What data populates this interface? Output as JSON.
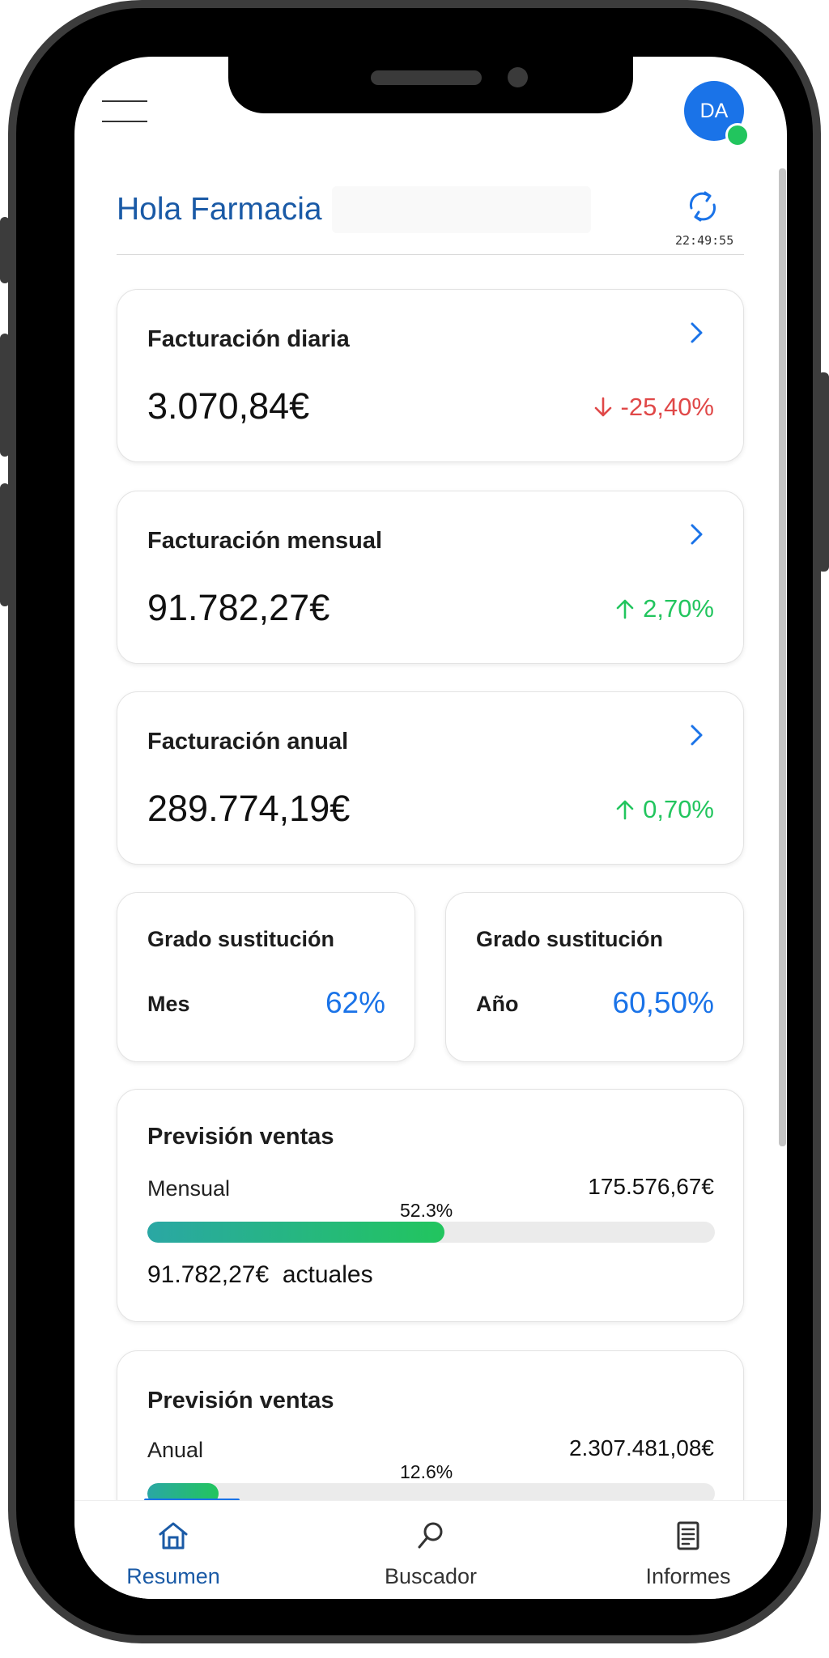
{
  "header": {
    "avatar_initials": "DA",
    "greeting": "Hola Farmacia",
    "last_update": "22:49:55"
  },
  "cards": [
    {
      "title": "Facturación diaria",
      "value": "3.070,84€",
      "delta": "-25,40%",
      "trend": "down"
    },
    {
      "title": "Facturación mensual",
      "value": "91.782,27€",
      "delta": "2,70%",
      "trend": "up"
    },
    {
      "title": "Facturación anual",
      "value": "289.774,19€",
      "delta": "0,70%",
      "trend": "up"
    }
  ],
  "substitution": [
    {
      "title": "Grado sustitución",
      "period": "Mes",
      "value": "62%"
    },
    {
      "title": "Grado sustitución",
      "period": "Año",
      "value": "60,50%"
    }
  ],
  "forecasts": [
    {
      "title": "Previsión ventas",
      "period": "Mensual",
      "target": "175.576,67€",
      "percent_label": "52.3%",
      "progress": 0.523,
      "current": "91.782,27€",
      "current_suffix": "actuales"
    },
    {
      "title": "Previsión ventas",
      "period": "Anual",
      "target": "2.307.481,08€",
      "percent_label": "12.6%",
      "progress": 0.126
    }
  ],
  "nav": [
    {
      "label": "Resumen",
      "icon": "home-icon",
      "active": true
    },
    {
      "label": "Buscador",
      "icon": "search-icon",
      "active": false
    },
    {
      "label": "Informes",
      "icon": "report-icon",
      "active": false
    }
  ],
  "colors": {
    "primary": "#1a73e8",
    "greeting": "#1a5aa6",
    "up": "#22c55e",
    "down": "#e04848",
    "progress_start": "#2aa7a4",
    "progress_end": "#22c55e",
    "nav_active": "#1a5aa6"
  }
}
